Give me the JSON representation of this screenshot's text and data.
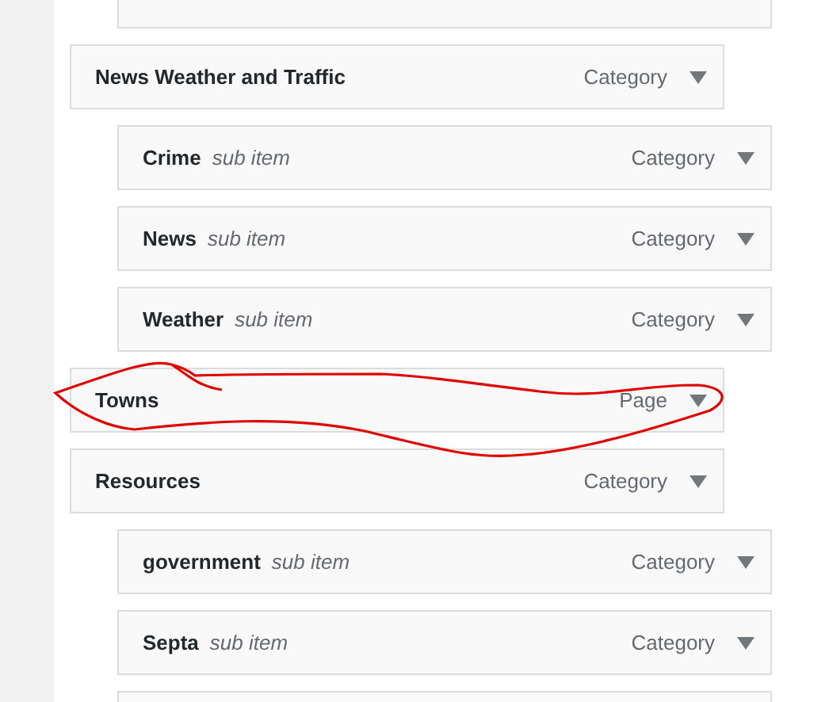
{
  "menu_items": [
    {
      "title": "News Weather and Traffic",
      "type": "Category",
      "children": [
        {
          "title": "Crime",
          "sub_label": "sub item",
          "type": "Category"
        },
        {
          "title": "News",
          "sub_label": "sub item",
          "type": "Category"
        },
        {
          "title": "Weather",
          "sub_label": "sub item",
          "type": "Category"
        }
      ]
    },
    {
      "title": "Towns",
      "type": "Page"
    },
    {
      "title": "Resources",
      "type": "Category",
      "children": [
        {
          "title": "government",
          "sub_label": "sub item",
          "type": "Category"
        },
        {
          "title": "Septa",
          "sub_label": "sub item",
          "type": "Category"
        }
      ]
    }
  ]
}
